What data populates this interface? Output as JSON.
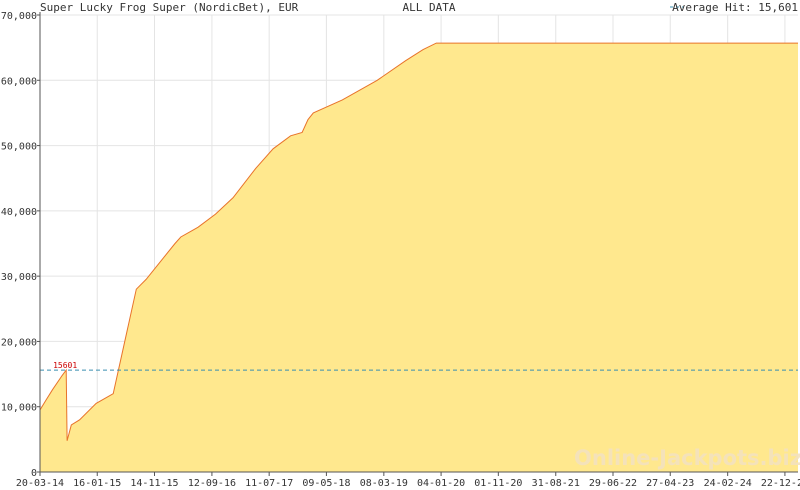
{
  "header": {
    "title": "Super Lucky Frog Super (NordicBet), EUR",
    "range_label": "ALL DATA",
    "average_label": "Average Hit: 15,601"
  },
  "watermark": "Online-Jackpots.biz",
  "colors": {
    "area_fill": "#ffe88e",
    "line": "#e8732a",
    "avg_line": "#3a8fb0",
    "grid": "#e4e4e4",
    "axis": "#555555",
    "annotation": "#cc0000"
  },
  "chart_data": {
    "type": "area",
    "title": "Super Lucky Frog Super (NordicBet), EUR",
    "xlabel": "",
    "ylabel": "",
    "ylim": [
      0,
      70000
    ],
    "yticks": [
      "0",
      "10,000",
      "20,000",
      "30,000",
      "40,000",
      "50,000",
      "60,000",
      "70,000"
    ],
    "ytick_values": [
      0,
      10000,
      20000,
      30000,
      40000,
      50000,
      60000,
      70000
    ],
    "xlim": [
      "2014-03-20",
      "2025-03-01"
    ],
    "xticks": [
      "20-03-14",
      "16-01-15",
      "14-11-15",
      "12-09-16",
      "11-07-17",
      "09-05-18",
      "08-03-19",
      "04-01-20",
      "01-11-20",
      "31-08-21",
      "29-06-22",
      "27-04-23",
      "24-02-24",
      "22-12-24"
    ],
    "xtick_dates": [
      "2014-03-20",
      "2015-01-16",
      "2015-11-14",
      "2016-09-12",
      "2017-07-11",
      "2018-05-09",
      "2019-03-08",
      "2020-01-04",
      "2020-11-01",
      "2021-08-31",
      "2022-06-29",
      "2023-04-27",
      "2024-02-24",
      "2024-12-22"
    ],
    "grid": true,
    "average_hit": 15601,
    "average_annotation": "15601",
    "series": [
      {
        "points": [
          [
            "2014-03-20",
            9500
          ],
          [
            "2014-04-20",
            11000
          ],
          [
            "2014-05-25",
            12600
          ],
          [
            "2014-07-15",
            14800
          ],
          [
            "2014-08-05",
            15601
          ],
          [
            "2014-08-10",
            4800
          ],
          [
            "2014-09-01",
            7200
          ],
          [
            "2014-10-15",
            8000
          ],
          [
            "2015-01-10",
            10500
          ],
          [
            "2015-04-10",
            12000
          ],
          [
            "2015-08-10",
            28000
          ],
          [
            "2015-10-01",
            29500
          ],
          [
            "2016-03-01",
            35000
          ],
          [
            "2016-04-01",
            36000
          ],
          [
            "2016-06-01",
            37000
          ],
          [
            "2016-07-01",
            37500
          ],
          [
            "2016-10-01",
            39500
          ],
          [
            "2017-01-01",
            42000
          ],
          [
            "2017-05-01",
            46500
          ],
          [
            "2017-08-01",
            49500
          ],
          [
            "2017-11-01",
            51500
          ],
          [
            "2018-01-01",
            52000
          ],
          [
            "2018-02-01",
            54000
          ],
          [
            "2018-03-01",
            55000
          ],
          [
            "2018-08-01",
            57000
          ],
          [
            "2019-02-01",
            60000
          ],
          [
            "2019-07-01",
            63000
          ],
          [
            "2019-10-01",
            64700
          ],
          [
            "2019-12-10",
            65700
          ],
          [
            "2025-03-01",
            65700
          ]
        ]
      }
    ]
  }
}
